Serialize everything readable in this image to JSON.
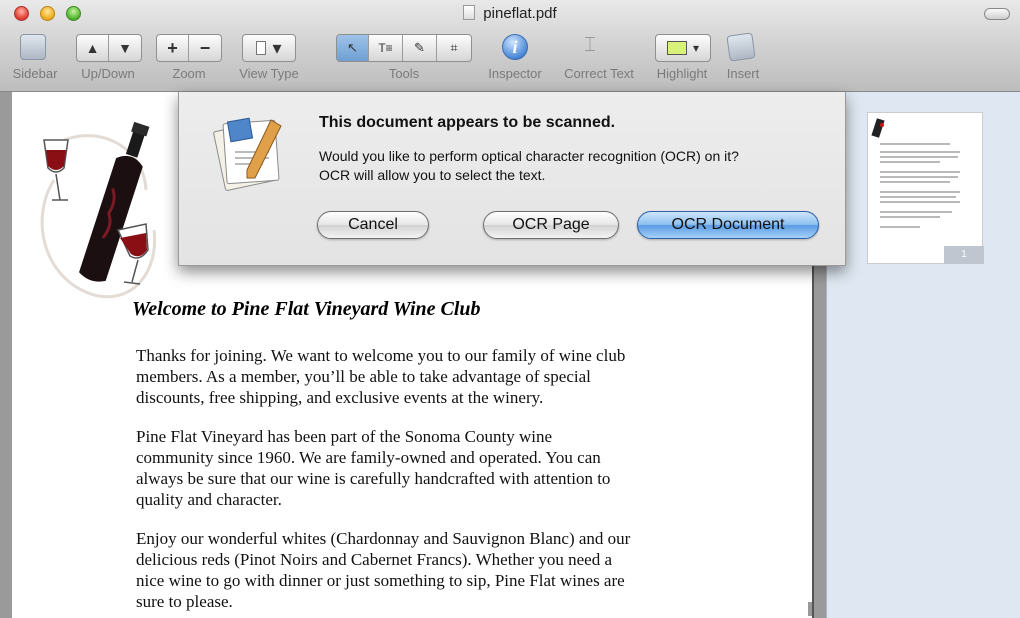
{
  "window": {
    "title": "pineflat.pdf"
  },
  "toolbar": {
    "sidebar_label": "Sidebar",
    "updown_label": "Up/Down",
    "zoom_label": "Zoom",
    "viewtype_label": "View Type",
    "tools_label": "Tools",
    "inspector_label": "Inspector",
    "correct_text_label": "Correct Text",
    "highlight_label": "Highlight",
    "insert_label": "Insert",
    "up_glyph": "▲",
    "down_glyph": "▼",
    "zoom_in_glyph": "+",
    "zoom_out_glyph": "−",
    "dropdown_glyph": "▾",
    "inspector_glyph": "i",
    "highlight_color": "#d9f27c"
  },
  "sheet": {
    "title": "This document appears to be scanned.",
    "message_line1": "Would you like to perform optical character recognition (OCR) on it?",
    "message_line2": "OCR will allow you to select the text.",
    "cancel_label": "Cancel",
    "ocr_page_label": "OCR Page",
    "ocr_document_label": "OCR Document"
  },
  "document": {
    "heading": "Welcome to Pine Flat Vineyard Wine Club",
    "paragraphs": [
      [
        "Thanks for joining. We want to welcome you to our family of wine club",
        "members. As a member, you’ll be able to take advantage of special",
        "discounts, free shipping, and exclusive events at the winery."
      ],
      [
        "Pine Flat Vineyard has been part of the Sonoma County wine",
        "community since 1960. We are family-owned and operated. You can",
        "always be sure that our wine is carefully handcrafted with attention to",
        "quality and character."
      ],
      [
        "Enjoy our wonderful whites (Chardonnay and Sauvignon Blanc) and our",
        "delicious reds  (Pinot Noirs and Cabernet Francs). Whether you need a",
        "nice wine to go with dinner or just something to sip, Pine Flat wines are",
        "sure to please."
      ]
    ]
  },
  "sidebar": {
    "page_badge": "1"
  }
}
